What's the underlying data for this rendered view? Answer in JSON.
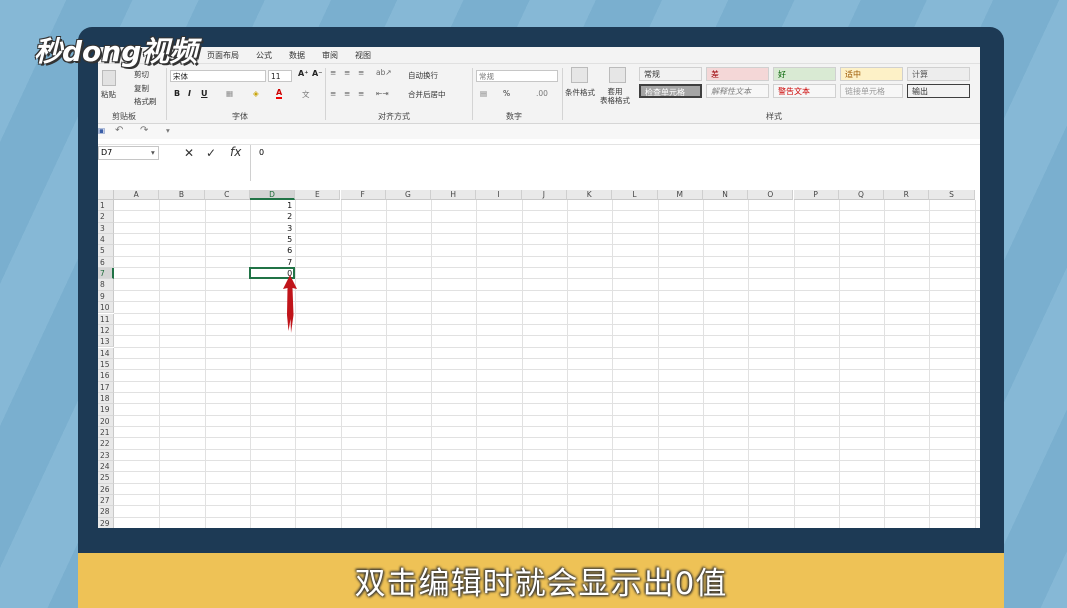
{
  "logo": {
    "text": "秒dong视频"
  },
  "caption": "双击编辑时就会显示出0值",
  "ribbon_tabs": [
    "页面布局",
    "公式",
    "数据",
    "审阅",
    "视图"
  ],
  "clipboard": {
    "paste": "粘贴",
    "cut": "剪切",
    "copy": "复制",
    "format_painter": "格式刷",
    "label": "剪贴板"
  },
  "font": {
    "name": "宋体",
    "size": "11",
    "bold": "B",
    "italic": "I",
    "underline": "U",
    "label": "字体"
  },
  "alignment": {
    "wrap": "自动换行",
    "merge": "合并后居中",
    "label": "对齐方式"
  },
  "number": {
    "format": "常规",
    "percent": "%",
    "label": "数字"
  },
  "styles": {
    "conditional": "条件格式",
    "table": "套用\n表格格式",
    "cells": [
      "常规",
      "差",
      "好",
      "适中",
      "计算",
      "检查单元格",
      "解释性文本",
      "警告文本",
      "链接单元格",
      "输出"
    ],
    "label": "样式"
  },
  "formula_bar": {
    "name_box": "D7",
    "value": "0"
  },
  "columns": [
    "A",
    "B",
    "C",
    "D",
    "E",
    "F",
    "G",
    "H",
    "I",
    "J",
    "K",
    "L",
    "M",
    "N",
    "O",
    "P",
    "Q",
    "R",
    "S"
  ],
  "rows": [
    "1",
    "2",
    "3",
    "4",
    "5",
    "6",
    "7",
    "8",
    "9",
    "10",
    "11",
    "12",
    "13",
    "14",
    "15",
    "16",
    "17",
    "18",
    "19",
    "20",
    "21",
    "22",
    "23",
    "24",
    "25",
    "26",
    "27",
    "28",
    "29"
  ],
  "cells": {
    "D1": "1",
    "D2": "2",
    "D3": "3",
    "D4": "5",
    "D5": "6",
    "D6": "7",
    "D7": "0"
  },
  "active_cell": "D7",
  "colors": {
    "accent": "#217346",
    "caption_bg": "#eec256",
    "monitor": "#1d3a55",
    "arrow": "#c0141a"
  }
}
